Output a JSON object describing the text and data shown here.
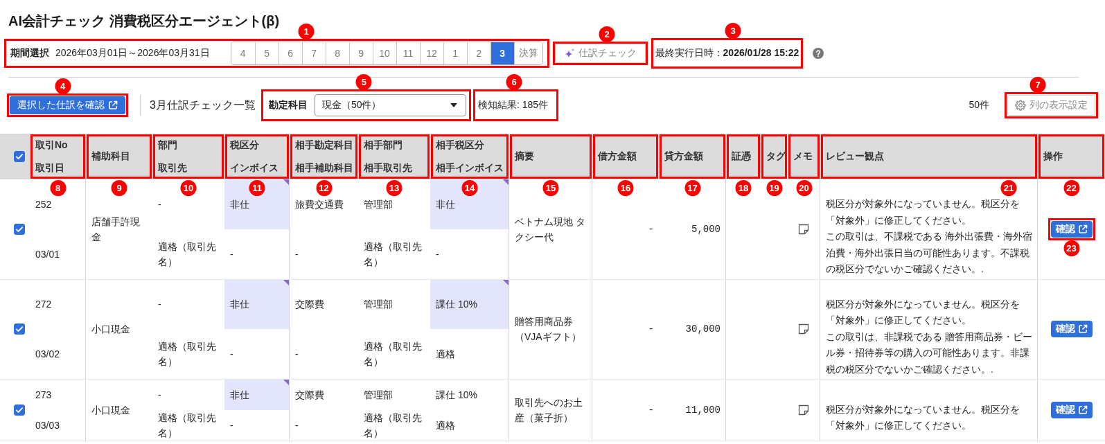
{
  "title": "AI会計チェック 消費税区分エージェント(β)",
  "period": {
    "label": "期間選択",
    "range": "2026年03月01日～2026年03月31日",
    "callout": "1",
    "months": [
      {
        "label": "4",
        "selected": false
      },
      {
        "label": "5",
        "selected": false
      },
      {
        "label": "6",
        "selected": false
      },
      {
        "label": "7",
        "selected": false
      },
      {
        "label": "8",
        "selected": false
      },
      {
        "label": "9",
        "selected": false
      },
      {
        "label": "10",
        "selected": false
      },
      {
        "label": "11",
        "selected": false
      },
      {
        "label": "12",
        "selected": false
      },
      {
        "label": "1",
        "selected": false
      },
      {
        "label": "2",
        "selected": false
      },
      {
        "label": "3",
        "selected": true
      },
      {
        "label": "決算",
        "selected": false
      }
    ]
  },
  "check_button": {
    "label": "仕訳チェック",
    "callout": "2"
  },
  "last_run": {
    "label": "最終実行日時：",
    "value": "2026/01/28 15:22",
    "callout": "3"
  },
  "toolbar": {
    "confirm_button": {
      "label": "選択した仕訳を確認",
      "callout": "4"
    },
    "list_title": "3月仕訳チェック一覧",
    "account_filter": {
      "label": "勘定科目",
      "value": "現金（50件）",
      "callout": "5"
    },
    "detections": {
      "text": "検知結果: 185件",
      "callout": "6"
    },
    "count": "50件",
    "column_settings": {
      "label": "列の表示設定",
      "callout": "7"
    }
  },
  "table": {
    "select_all": {
      "checked": true
    },
    "columns": [
      {
        "label": "取引No",
        "sub_label": "取引日",
        "callout": "8"
      },
      {
        "label": "補助科目",
        "callout": "9"
      },
      {
        "label": "部門",
        "sub_label": "取引先",
        "callout": "10"
      },
      {
        "label": "税区分",
        "sub_label": "インボイス",
        "callout": "11"
      },
      {
        "label": "相手勘定科目",
        "sub_label": "相手補助科目",
        "callout": "12"
      },
      {
        "label": "相手部門",
        "sub_label": "相手取引先",
        "callout": "13"
      },
      {
        "label": "相手税区分",
        "sub_label": "相手インボイス",
        "callout": "14"
      },
      {
        "label": "摘要",
        "callout": "15"
      },
      {
        "label": "借方金額",
        "callout": "16"
      },
      {
        "label": "貸方金額",
        "callout": "17"
      },
      {
        "label": "証憑",
        "callout": "18"
      },
      {
        "label": "タグ",
        "callout": "19"
      },
      {
        "label": "メモ",
        "callout": "20"
      },
      {
        "label": "レビュー観点",
        "callout": "21"
      },
      {
        "label": "操作",
        "callout": "22"
      }
    ],
    "rows": [
      {
        "checked": true,
        "no": "252",
        "date": "03/01",
        "sub_account": "店舗手許現金",
        "department": "-",
        "partner": "適格（取引先名）",
        "tax_class": "非仕",
        "tax_class_flagged": true,
        "invoice": "-",
        "counter_account": "旅費交通費",
        "counter_sub_account": "-",
        "counter_department": "管理部",
        "counter_partner": "適格（取引先名）",
        "counter_tax_class": "非仕",
        "counter_tax_class_flagged": true,
        "counter_invoice": "-",
        "description": "ベトナム現地 タクシー代",
        "debit": "-",
        "credit": "5,000",
        "review": [
          "税区分が対象外になっていません。税区分を「対象外」に修正してください。",
          "この取引は、不課税である 海外出張費・海外宿泊費・海外出張日当の可能性あります。不課税の税区分でないかご確認ください。."
        ],
        "action": {
          "label": "確認",
          "callout": "23"
        }
      },
      {
        "checked": true,
        "no": "272",
        "date": "03/02",
        "sub_account": "小口現金",
        "department": "-",
        "partner": "適格（取引先名）",
        "tax_class": "非仕",
        "tax_class_flagged": true,
        "invoice": "-",
        "counter_account": "交際費",
        "counter_sub_account": "-",
        "counter_department": "管理部",
        "counter_partner": "適格（取引先名）",
        "counter_tax_class": "課仕 10%",
        "counter_tax_class_flagged": true,
        "counter_invoice": "適格",
        "description": "贈答用商品券（VJAギフト）",
        "debit": "-",
        "credit": "30,000",
        "review": [
          "税区分が対象外になっていません。税区分を「対象外」に修正してください。",
          "この取引は、非課税である 贈答用商品券・ビール券・招待券等の購入の可能性あります。非課税の税区分でないかご確認ください。."
        ],
        "action": {
          "label": "確認"
        }
      },
      {
        "checked": true,
        "no": "273",
        "date": "03/03",
        "sub_account": "小口現金",
        "department": "-",
        "partner": "適格（取引先名）",
        "tax_class": "非仕",
        "tax_class_flagged": true,
        "invoice": "-",
        "counter_account": "交際費",
        "counter_sub_account": "-",
        "counter_department": "管理部",
        "counter_partner": "適格（取引先名）",
        "counter_tax_class": "課仕 10%",
        "counter_tax_class_flagged": false,
        "counter_invoice": "適格",
        "description": "取引先へのお土産（菓子折）",
        "debit": "-",
        "credit": "11,000",
        "review": [
          "税区分が対象外になっていません。税区分を「対象外」に修正してください。"
        ],
        "action": {
          "label": "確認"
        }
      }
    ]
  }
}
